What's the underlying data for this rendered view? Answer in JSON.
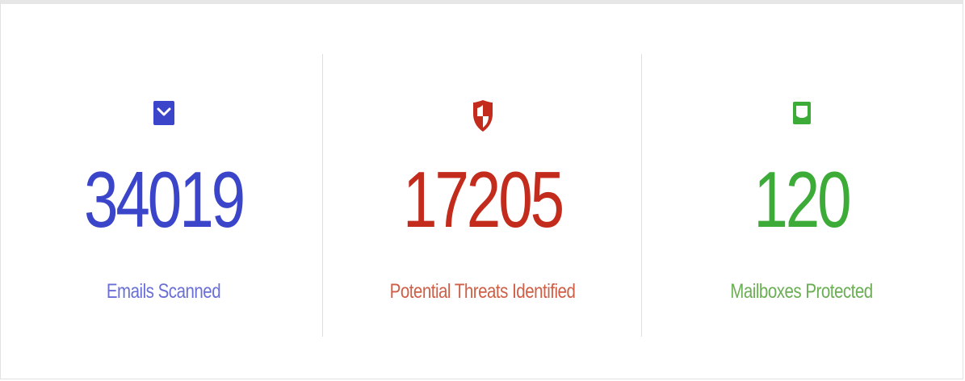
{
  "stats": [
    {
      "icon": "envelope-icon",
      "value": "34019",
      "label": "Emails Scanned",
      "color": "#3a45c9",
      "label_color": "#6a6fd6"
    },
    {
      "icon": "shield-icon",
      "value": "17205",
      "label": "Potential Threats Identified",
      "color": "#c32b1c",
      "label_color": "#cf5f46"
    },
    {
      "icon": "mailbox-icon",
      "value": "120",
      "label": "Mailboxes Protected",
      "color": "#3cab38",
      "label_color": "#6cae55"
    }
  ]
}
